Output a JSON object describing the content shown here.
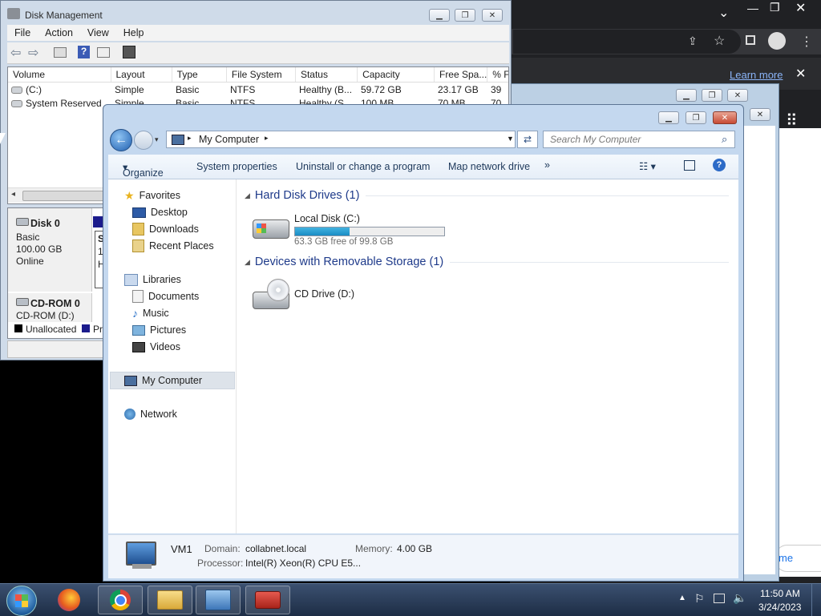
{
  "chrome": {
    "learn_more": "Learn more",
    "partial_text": "me"
  },
  "disk_management": {
    "title": "Disk Management",
    "menu": [
      "File",
      "Action",
      "View",
      "Help"
    ],
    "columns": [
      "Volume",
      "Layout",
      "Type",
      "File System",
      "Status",
      "Capacity",
      "Free Spa...",
      "% F"
    ],
    "rows": [
      [
        "(C:)",
        "Simple",
        "Basic",
        "NTFS",
        "Healthy (B...",
        "59.72 GB",
        "23.17 GB",
        "39"
      ],
      [
        "System Reserved",
        "Simple",
        "Basic",
        "NTFS",
        "Healthy (S...",
        "100 MB",
        "70 MB",
        "70"
      ]
    ],
    "disk0": {
      "name": "Disk 0",
      "type": "Basic",
      "size": "100.00 GB",
      "state": "Online"
    },
    "cdrom0": {
      "name": "CD-ROM 0",
      "drive": "CD-ROM (D:)"
    },
    "legend": {
      "unallocated": "Unallocated",
      "primary": "Pri"
    },
    "partition_partial": {
      "a": "S",
      "b": "1",
      "c": "H"
    }
  },
  "explorer": {
    "breadcrumb": "My Computer",
    "search_placeholder": "Search My Computer",
    "commands": [
      "Organize",
      "System properties",
      "Uninstall or change a program",
      "Map network drive"
    ],
    "more": "»",
    "nav": {
      "favorites": "Favorites",
      "favorites_items": [
        "Desktop",
        "Downloads",
        "Recent Places"
      ],
      "libraries": "Libraries",
      "library_items": [
        "Documents",
        "Music",
        "Pictures",
        "Videos"
      ],
      "computer": "My Computer",
      "network": "Network"
    },
    "groups": {
      "hdd": "Hard Disk Drives (1)",
      "removable": "Devices with Removable Storage (1)"
    },
    "local_disk": {
      "name": "Local Disk (C:)",
      "free": "63.3 GB free of 99.8 GB",
      "used_fraction": 0.366
    },
    "cd_drive": {
      "name": "CD Drive (D:)"
    },
    "details": {
      "name": "VM1",
      "domain_label": "Domain:",
      "domain": "collabnet.local",
      "memory_label": "Memory:",
      "memory": "4.00 GB",
      "processor_label": "Processor:",
      "processor": "Intel(R) Xeon(R) CPU E5..."
    }
  },
  "taskbar": {
    "time": "11:50 AM",
    "date": "3/24/2023"
  }
}
